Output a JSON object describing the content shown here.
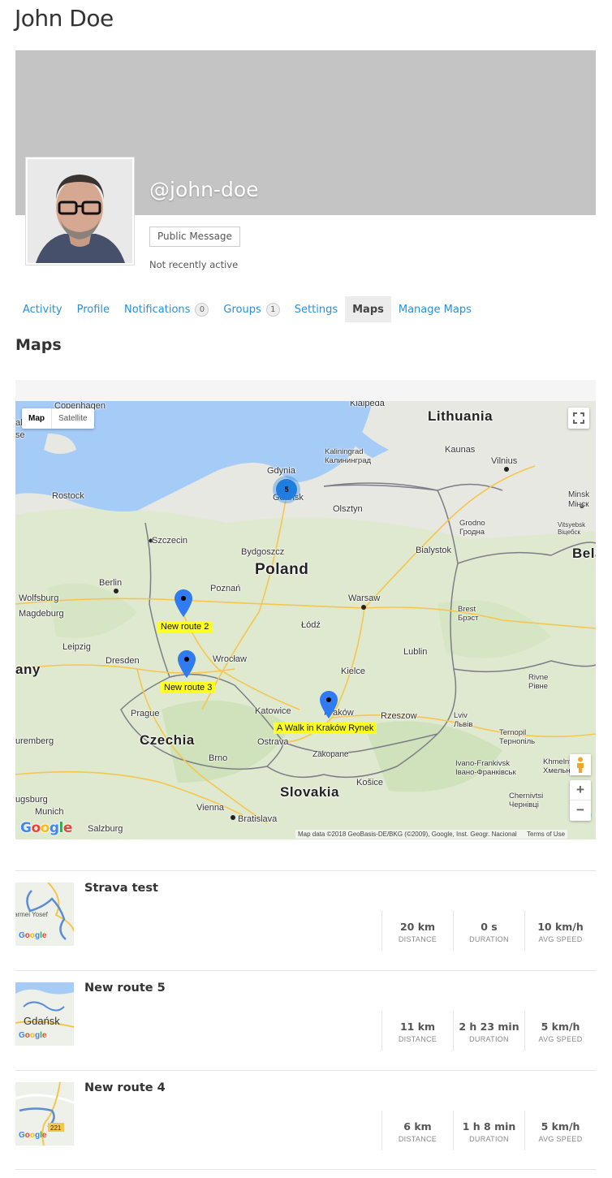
{
  "profile": {
    "name": "John Doe",
    "handle": "@john-doe",
    "public_message_label": "Public Message",
    "activity_status": "Not recently active"
  },
  "nav": {
    "items": [
      {
        "label": "Activity"
      },
      {
        "label": "Profile"
      },
      {
        "label": "Notifications",
        "count": "0"
      },
      {
        "label": "Groups",
        "count": "1"
      },
      {
        "label": "Settings"
      },
      {
        "label": "Maps",
        "active": true
      },
      {
        "label": "Manage Maps"
      }
    ]
  },
  "section_title": "Maps",
  "map": {
    "type_controls": {
      "map": "Map",
      "satellite": "Satellite"
    },
    "zoom": {
      "in": "+",
      "out": "−"
    },
    "fullscreen_icon": "fullscreen-icon",
    "attribution": "Map data ©2018 GeoBasis-DE/BKG (©2009), Google, Inst. Geogr. Nacional",
    "terms": "Terms of Use",
    "logo": "Google",
    "colors": {
      "water": "#a5cbf7",
      "land": "#e8e8e2",
      "green": "#d6e6c4",
      "route_tag": "#ffff22",
      "pin": "#2f7bef"
    },
    "cluster": {
      "count": "5"
    },
    "route_tags": {
      "route2": "New route 2",
      "route3": "New route 3",
      "krakow": "A Walk in Kraków Rynek"
    },
    "labels": {
      "lithuania": "Lithuania",
      "poland": "Poland",
      "czechia": "Czechia",
      "slovakia": "Slovakia",
      "bela": "Bela",
      "any": "any",
      "copenhagen": "Copenhagen",
      "malmo": "almö",
      "rostock": "Rostock",
      "szczecin": "Szczecin",
      "gdynia": "Gdynia",
      "gdansk": "Gdańsk",
      "klaipeda": "Klaipeda",
      "kaliningrad": "Kaliningrad\nКалининград",
      "kaunas": "Kaunas",
      "vilnius": "Vilnius",
      "olsztyn": "Olsztyn",
      "grodno": "Grodno\nГродна",
      "minsk": "Minsk\nМінск",
      "bialystok": "Bialystok",
      "bydgoszcz": "Bydgoszcz",
      "poznan": "Poznań",
      "berlin": "Berlin",
      "wolfsburg": "Wolfsburg",
      "magdeburg": "Magdeburg",
      "warsaw": "Warsaw",
      "lodz": "Łódź",
      "brest": "Brest\nБрэст",
      "leipzig": "Leipzig",
      "dresden": "Dresden",
      "wroclaw": "Wrocław",
      "lublin": "Lublin",
      "kielce": "Kielce",
      "rivne": "Rivne\nРівне",
      "prague": "Prague",
      "katowice": "Katowice",
      "krakow": "Kraków",
      "rzeszow": "Rzeszow",
      "lviv": "Lviv\nЛьвів",
      "ternopil": "Ternopil\nТернопіль",
      "ostrava": "Ostrava",
      "zakopane": "Zakopane",
      "brno": "Brno",
      "kosice": "Košice",
      "ivano": "Ivano-Frankivsk\nІвано-Франківськ",
      "khmelny": "Khmelny\nХмельни",
      "chernivtsi": "Chernivtsi\nЧернівці",
      "nuremberg": "uremberg",
      "augsburg": "ugsburg",
      "munich": "Munich",
      "salzburg": "Salzburg",
      "vienna": "Vienna",
      "bratislava": "Bratislava",
      "vitebsk": "Vitsyebsk\nВіцебск",
      "se": "se"
    }
  },
  "routes": [
    {
      "name": "Strava test",
      "thumb_text": "armei Yosef",
      "stats": [
        {
          "value": "20 km",
          "label": "DISTANCE"
        },
        {
          "value": "0 s",
          "label": "DURATION"
        },
        {
          "value": "10 km/h",
          "label": "AVG SPEED"
        }
      ]
    },
    {
      "name": "New route 5",
      "thumb_text": "Gdańsk",
      "stats": [
        {
          "value": "11 km",
          "label": "DISTANCE"
        },
        {
          "value": "2 h 23 min",
          "label": "DURATION"
        },
        {
          "value": "5 km/h",
          "label": "AVG SPEED"
        }
      ]
    },
    {
      "name": "New route 4",
      "thumb_text": "221",
      "stats": [
        {
          "value": "6 km",
          "label": "DISTANCE"
        },
        {
          "value": "1 h 8 min",
          "label": "DURATION"
        },
        {
          "value": "5 km/h",
          "label": "AVG SPEED"
        }
      ]
    }
  ]
}
